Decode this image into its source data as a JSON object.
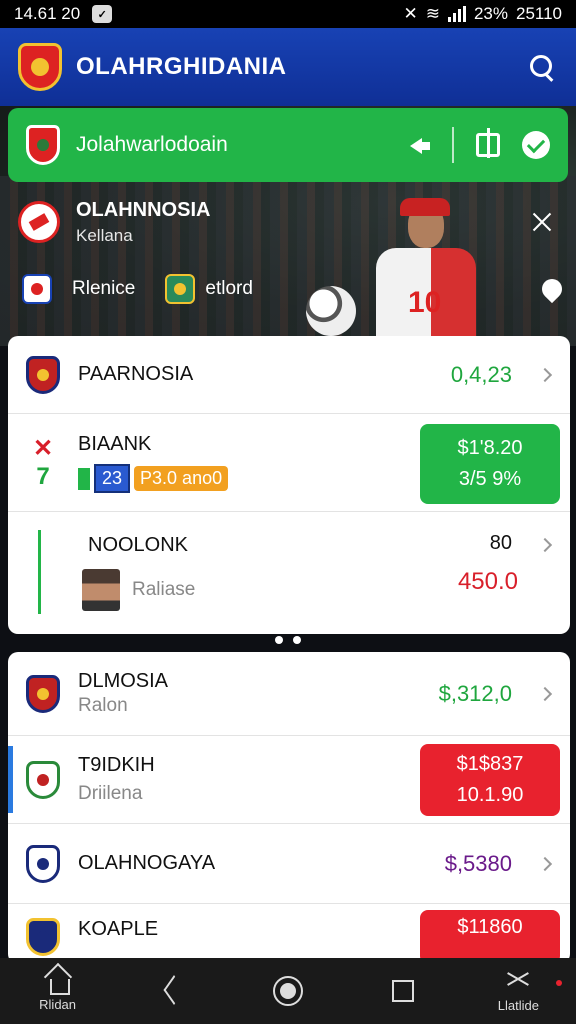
{
  "status_bar": {
    "left_time": "14.61 20",
    "battery": "23%",
    "right_time": "25110"
  },
  "app_bar": {
    "title": "OLAHRGHIDANIA"
  },
  "banner": {
    "label": "Jolahwarlodoain"
  },
  "match": {
    "title": "OLAHNNOSIA",
    "subtitle": "Kellana"
  },
  "teams": {
    "home": "Rlenice",
    "away": "etlord"
  },
  "list1": [
    {
      "name": "PAARNOSIA",
      "value": "0,4,23"
    },
    {
      "name": "BIAANK",
      "tag1": "23",
      "tag2": "P3.0 ano0",
      "price_top": "$1'8.20",
      "price_bottom": "3/5 9%"
    },
    {
      "name": "NOOLONK",
      "sub": "Raliase",
      "value_top": "80",
      "value": "450.0"
    }
  ],
  "list2": [
    {
      "name": "DLMOSIA",
      "sub": "Ralon",
      "value": "$,312,0"
    },
    {
      "name": "T9IDKIH",
      "sub": "Driilena",
      "price_top": "$1$837",
      "price_bottom": "10.1.90"
    },
    {
      "name": "OLAHNOGAYA",
      "value": "$,5380"
    },
    {
      "name": "KOAPLE",
      "price_top": "$11860"
    }
  ],
  "bottom_nav": {
    "home_label": "Rlidan",
    "tools_label": "Llatlide"
  }
}
